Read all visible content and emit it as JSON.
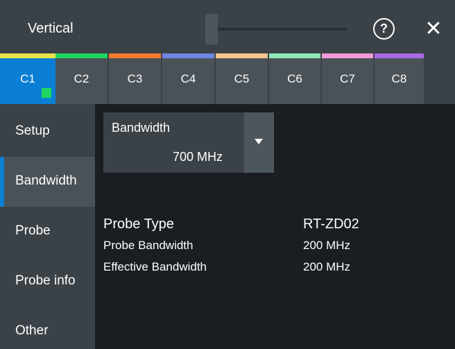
{
  "title": "Vertical",
  "help_glyph": "?",
  "close_glyph": "✕",
  "tabs": [
    {
      "label": "C1",
      "color": "#e8e34a",
      "active": true
    },
    {
      "label": "C2",
      "color": "#1ed760"
    },
    {
      "label": "C3",
      "color": "#f07a2e"
    },
    {
      "label": "C4",
      "color": "#6f86e3"
    },
    {
      "label": "C5",
      "color": "#f5c48f"
    },
    {
      "label": "C6",
      "color": "#8fe7b9"
    },
    {
      "label": "C7",
      "color": "#f29ad9"
    },
    {
      "label": "C8",
      "color": "#a86be3"
    }
  ],
  "sidebar": {
    "items": [
      {
        "label": "Setup"
      },
      {
        "label": "Bandwidth",
        "active": true
      },
      {
        "label": "Probe"
      },
      {
        "label": "Probe info"
      },
      {
        "label": "Other"
      }
    ]
  },
  "bandwidth": {
    "label": "Bandwidth",
    "value": "700 MHz"
  },
  "probe": {
    "type_label": "Probe Type",
    "type_value": "RT-ZD02",
    "bw_label": "Probe Bandwidth",
    "bw_value": "200 MHz",
    "eff_label": "Effective Bandwidth",
    "eff_value": "200 MHz"
  }
}
